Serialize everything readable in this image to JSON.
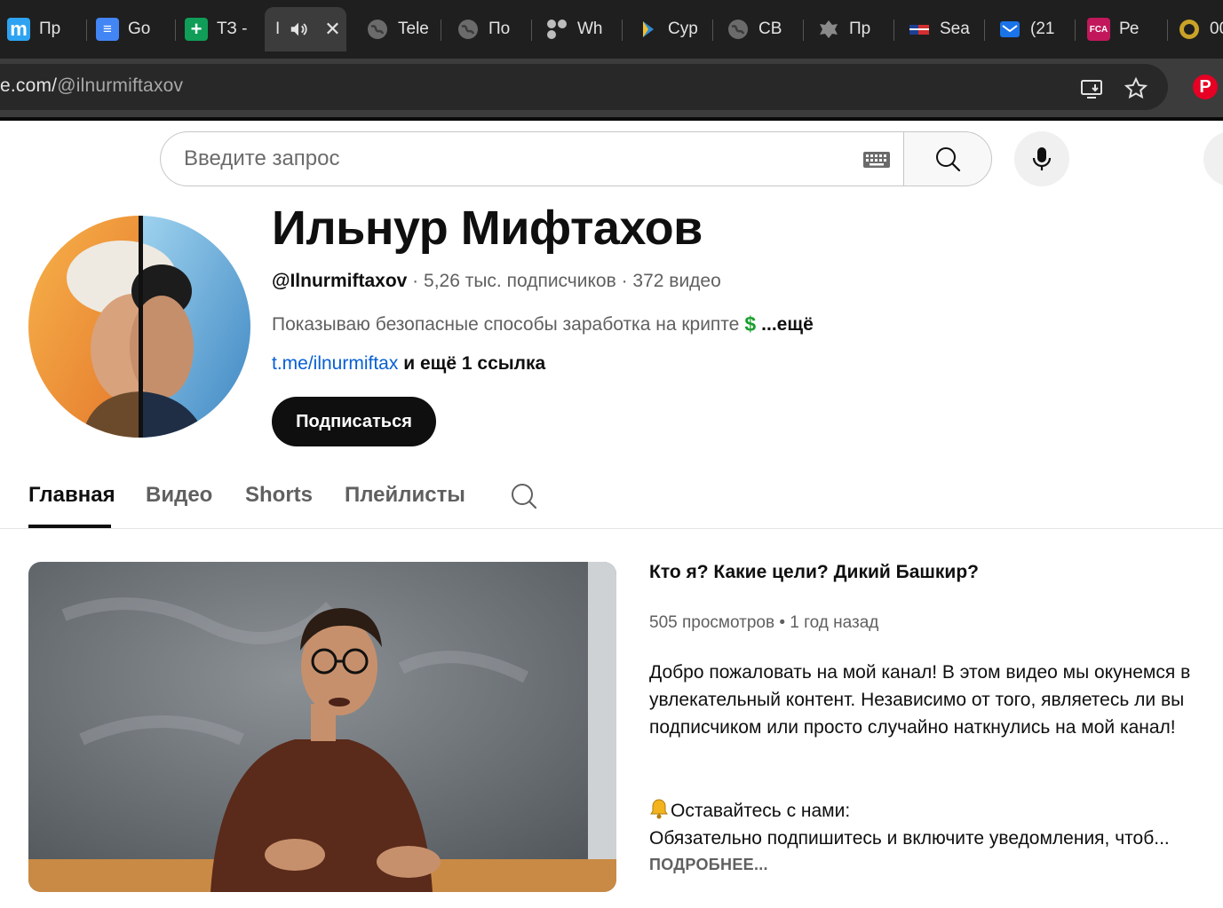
{
  "browser": {
    "tabs": [
      {
        "title": "Пр",
        "favicon_text": "m",
        "favicon_color": "#2ea3f2"
      },
      {
        "title": "Go",
        "favicon_text": "≡",
        "favicon_color": "#4285f4"
      },
      {
        "title": "ТЗ -",
        "favicon_text": "+",
        "favicon_color": "#0f9d58"
      },
      {
        "title": "I",
        "favicon_text": "",
        "favicon_color": "#3c3c3c"
      },
      {
        "title": "Tele",
        "favicon_text": "",
        "favicon_color": "#6b6b6b"
      },
      {
        "title": "По",
        "favicon_text": "",
        "favicon_color": "#6b6b6b"
      },
      {
        "title": "Wh",
        "favicon_text": "",
        "favicon_color": "#9a9a9a"
      },
      {
        "title": "Cyp",
        "favicon_text": "",
        "favicon_color": "#3c3c3c"
      },
      {
        "title": "CB",
        "favicon_text": "",
        "favicon_color": "#6b6b6b"
      },
      {
        "title": "Пр",
        "favicon_text": "",
        "favicon_color": "#6b6b6b"
      },
      {
        "title": "Sea",
        "favicon_text": "",
        "favicon_color": "#3c3c3c"
      },
      {
        "title": "(21",
        "favicon_text": "",
        "favicon_color": "#1a73e8"
      },
      {
        "title": "Ре",
        "favicon_text": "FCA",
        "favicon_color": "#c2185b"
      },
      {
        "title": "00",
        "favicon_text": "",
        "favicon_color": "#c9a227"
      }
    ],
    "address": {
      "url_prefix": "e.com/",
      "url_path": "@ilnurmiftaxov"
    },
    "pinterest_badge": "P"
  },
  "masthead": {
    "search_placeholder": "Введите запрос"
  },
  "channel": {
    "name": "Ильнур Мифтахов",
    "handle": "@Ilnurmiftaxov",
    "subscribers": "5,26 тыс. подписчиков",
    "videos_count": "372 видео",
    "meta_separator": " · ",
    "description": "Показываю безопасные способы заработка на крипте",
    "description_emoji": "$",
    "description_more": "...ещё",
    "link_text": "t.me/ilnurmiftax",
    "more_links": "и ещё 1 ссылка",
    "subscribe_label": "Подписаться"
  },
  "tabs": [
    {
      "label": "Главная",
      "active": true
    },
    {
      "label": "Видео",
      "active": false
    },
    {
      "label": "Shorts",
      "active": false
    },
    {
      "label": "Плейлисты",
      "active": false
    }
  ],
  "featured_video": {
    "title": "Кто я? Какие цели? Дикий Башкир?",
    "views": "505 просмотров",
    "age": "1 год назад",
    "meta_separator": " • ",
    "description": "Добро пожаловать на мой канал! В этом видео мы окунемся в увлекательный контент. Независимо от того, являетесь ли вы подписчиком или просто случайно наткнулись на мой канал!",
    "notify_line": "Оставайтесь с нами:",
    "notify_detail": "Обязательно подпишитесь и включите уведомления, чтоб...",
    "read_more": "ПОДРОБНЕЕ..."
  },
  "colors": {
    "chrome_bg": "#1f1f1f",
    "toolbar_bg": "#3c3c3c",
    "link_blue": "#065fd4",
    "subscribe_bg": "#0f0f0f",
    "secondary_text": "#606060"
  },
  "icons": {
    "keyboard": "keyboard-icon",
    "search": "search-icon",
    "mic": "microphone-icon",
    "install": "install-app-icon",
    "bookmark": "star-icon",
    "bell": "bell-icon",
    "speaker": "speaker-icon",
    "close": "close-icon"
  }
}
